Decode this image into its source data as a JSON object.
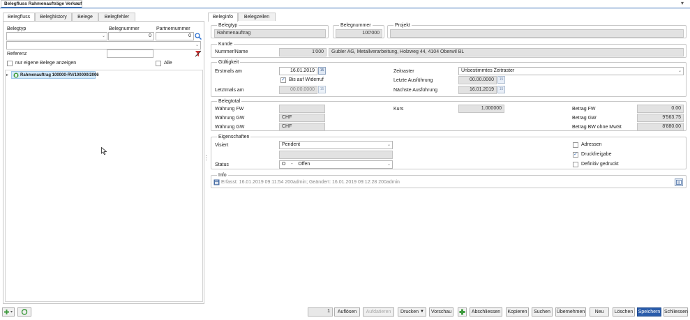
{
  "window": {
    "tab_title": "Belegfluss Rahmenaufträge Verkauf",
    "close_glyph": "×",
    "menu_glyph": "▾"
  },
  "left": {
    "tabs": [
      {
        "label": "Belegfluss"
      },
      {
        "label": "Beleghistory"
      },
      {
        "label": "Belege"
      },
      {
        "label": "Belegfehler"
      }
    ],
    "filter": {
      "belegtyp_label": "Belegtyp",
      "belegnummer_label": "Belegnummer",
      "belegnummer_value": "0",
      "partnernummer_label": "Partnernummer",
      "partnernummer_value": "0",
      "referenz_label": "Referenz",
      "only_own_label": "nur eigene Belege anzeigen",
      "alle_label": "Alle"
    },
    "tree": {
      "node_label": "Rahmenauftrag 100000-RV/100000/2006"
    }
  },
  "right": {
    "tabs": [
      {
        "label": "Beleginfo"
      },
      {
        "label": "Belegzeilen"
      }
    ],
    "belegtyp": {
      "title": "Belegtyp",
      "value": "Rahmenauftrag"
    },
    "belegnummer": {
      "title": "Belegnummer",
      "value": "100'000"
    },
    "projekt": {
      "title": "Projekt",
      "value": ""
    },
    "kunde": {
      "title": "Kunde",
      "label": "Nummer/Name",
      "number": "1'000",
      "name": "Gubler AG, Metallverarbeitung, Holzweg 44, 4104 Oberwil BL"
    },
    "gueltigkeit": {
      "title": "Gültigkeit",
      "erstmals_label": "Erstmals am",
      "erstmals_value": "16.01.2019",
      "widerruf_label": "Bis auf Widerruf",
      "letztmals_label": "Letztmals am",
      "letztmals_value": "00.00.0000",
      "zeitraster_label": "Zeitraster",
      "zeitraster_value": "Unbestimmtes Zeitraster",
      "letzte_label": "Letzte Ausführung",
      "letzte_value": "00.00.0000",
      "naechste_label": "Nächste Ausführung",
      "naechste_value": "16.01.2019"
    },
    "belegtotal": {
      "title": "Belegtotal",
      "waehrung_fw_label": "Währung FW",
      "waehrung_fw_value": "",
      "waehrung_gw_label": "Währung GW",
      "waehrung_gw_value": "CHF",
      "waehrung_gw2_label": "Währung GW",
      "waehrung_gw2_value": "CHF",
      "kurs_label": "Kurs",
      "kurs_value": "1.000000",
      "betrag_fw_label": "Betrag FW",
      "betrag_fw_value": "0.00",
      "betrag_gw_label": "Betrag GW",
      "betrag_gw_value": "9'563.75",
      "betrag_bw_label": "Betrag BW ohne MwSt",
      "betrag_bw_value": "8'880.00"
    },
    "eigenschaften": {
      "title": "Eigenschaften",
      "visiert_label": "Visiert",
      "visiert_value": "Pendent",
      "status_label": "Status",
      "status_value": "O    -    Offen",
      "adressen_label": "Adressen",
      "druckfreigabe_label": "Druckfreigabe",
      "definitiv_label": "Definitiv gedruckt"
    },
    "info": {
      "title": "Info",
      "text": "Erfasst: 16.01.2019 09:11:54 200admin; Geändert: 16.01.2019 09:12:28 200admin"
    }
  },
  "toolbar": {
    "counter": "1",
    "aufloesen": "Auflösen",
    "aufdatieren": "Aufdatieren",
    "drucken": "Drucken",
    "vorschau": "Vorschau",
    "abschliessen": "Abschliessen",
    "kopieren": "Kopieren",
    "suchen": "Suchen",
    "uebernehmen": "Übernehmen",
    "neu": "Neu",
    "loeschen": "Löschen",
    "speichern": "Speichern",
    "schliessen": "Schliessen"
  },
  "colors": {
    "primary": "#2a5caa",
    "tab_border": "#c8c8c8",
    "readonly_bg": "#e2e2e2"
  }
}
